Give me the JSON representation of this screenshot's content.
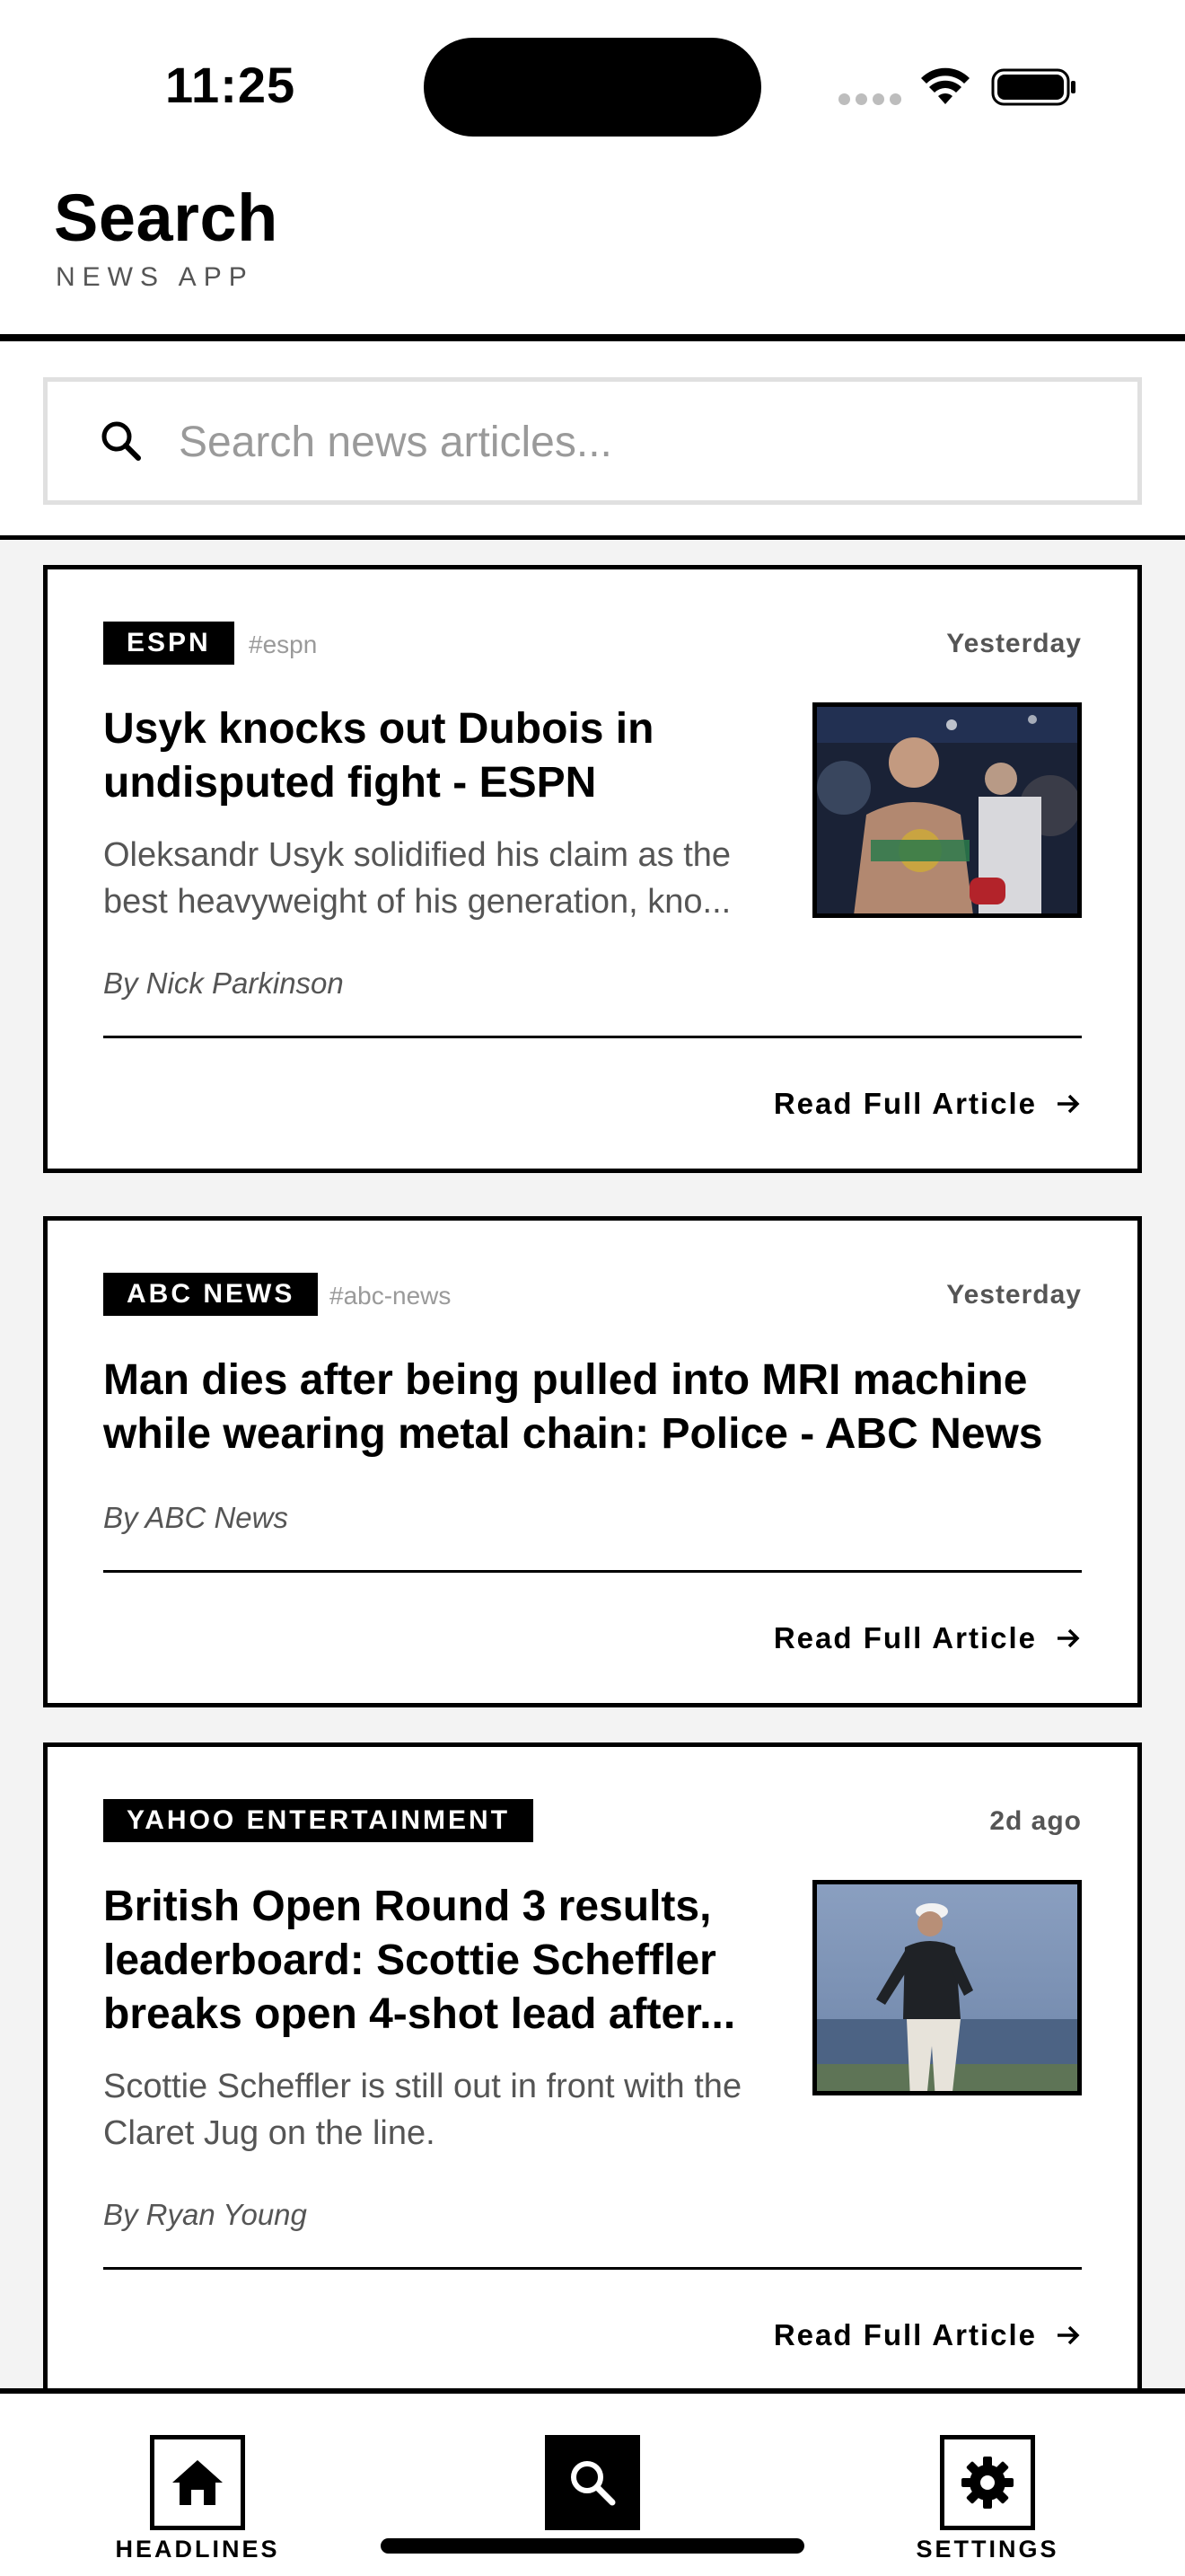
{
  "status_bar": {
    "time": "11:25"
  },
  "header": {
    "title": "Search",
    "subtitle": "NEWS APP"
  },
  "search": {
    "placeholder": "Search news articles...",
    "value": ""
  },
  "articles": [
    {
      "source": "ESPN",
      "tag": "#espn",
      "time": "Yesterday",
      "headline": "Usyk knocks out Dubois in undisputed fight - ESPN",
      "description": "Oleksandr Usyk solidified his claim as the best heavyweight of his generation, kno...",
      "byline": "By Nick Parkinson",
      "read_more": "Read Full Article",
      "image": "boxer-with-championship-belt-photo"
    },
    {
      "source": "ABC NEWS",
      "tag": "#abc-news",
      "time": "Yesterday",
      "headline": "Man dies after being pulled into MRI machine while wearing metal chain: Police - ABC News",
      "byline": "By ABC News",
      "read_more": "Read Full Article"
    },
    {
      "source": "YAHOO ENTERTAINMENT",
      "time": "2d ago",
      "headline": "British Open Round 3 results, leaderboard: Scottie Scheffler breaks open 4-shot lead after...",
      "description": "Scottie Scheffler is still out in front with the Claret Jug on the line.",
      "byline": "By Ryan Young",
      "read_more": "Read Full Article",
      "image": "golfer-walking-photo"
    }
  ],
  "tab_bar": {
    "tabs": [
      {
        "label": "HEADLINES",
        "icon": "home-icon",
        "active": false
      },
      {
        "label": "",
        "icon": "search-icon",
        "active": true
      },
      {
        "label": "SETTINGS",
        "icon": "gear-icon",
        "active": false
      }
    ]
  },
  "colors": {
    "accent": "#000000",
    "feed_background": "#f3f3f3",
    "muted_text": "#555555"
  }
}
